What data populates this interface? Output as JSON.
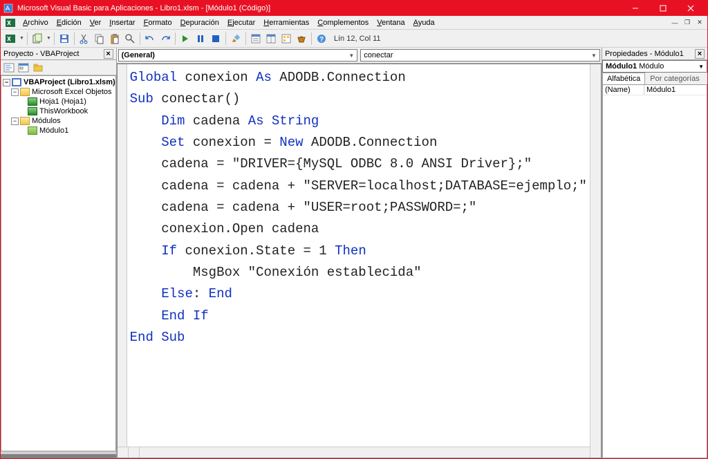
{
  "title": "Microsoft Visual Basic para Aplicaciones - Libro1.xlsm - [Módulo1 (Código)]",
  "menus": [
    "Archivo",
    "Edición",
    "Ver",
    "Insertar",
    "Formato",
    "Depuración",
    "Ejecutar",
    "Herramientas",
    "Complementos",
    "Ventana",
    "Ayuda"
  ],
  "menu_mnemonics": [
    "A",
    "E",
    "V",
    "I",
    "F",
    "D",
    "E",
    "H",
    "C",
    "V",
    "A"
  ],
  "status": "Lín 12, Col 11",
  "project_panel_title": "Proyecto - VBAProject",
  "tree": {
    "root": "VBAProject (Libro1.xlsm)",
    "folder1": "Microsoft Excel Objetos",
    "sheet1": "Hoja1 (Hoja1)",
    "wb": "ThisWorkbook",
    "folder2": "Módulos",
    "mod1": "Módulo1"
  },
  "dd_left": "(General)",
  "dd_right": "conectar",
  "props_panel_title": "Propiedades - Módulo1",
  "props_object_name": "Módulo1",
  "props_object_type": "Módulo",
  "props_tab1": "Alfabética",
  "props_tab2": "Por categorías",
  "props_row_key": "(Name)",
  "props_row_val": "Módulo1",
  "code": {
    "l1a": "Global",
    "l1b": " conexion ",
    "l1c": "As",
    "l1d": " ADODB.Connection",
    "l2a": "Sub",
    "l2b": " conectar()",
    "l3a": "Dim",
    "l3b": " cadena ",
    "l3c": "As String",
    "l4a": "Set",
    "l4b": " conexion = ",
    "l4c": "New",
    "l4d": " ADODB.Connection",
    "l5": "cadena = \"DRIVER={MySQL ODBC 8.0 ANSI Driver};\"",
    "l6": "cadena = cadena + \"SERVER=localhost;DATABASE=ejemplo;\"",
    "l7": "cadena = cadena + \"USER=root;PASSWORD=;\"",
    "l8": "conexion.Open cadena",
    "l9a": "If",
    "l9b": " conexion.State = 1 ",
    "l9c": "Then",
    "l10": "MsgBox \"Conexión establecida\"",
    "l11a": "Else",
    "l11b": ": ",
    "l11c": "End",
    "l12": "End If",
    "l13": "End Sub"
  }
}
